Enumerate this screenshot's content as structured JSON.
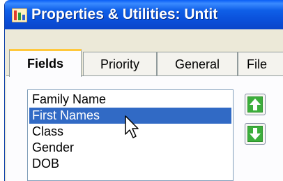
{
  "window": {
    "title": "Properties & Utilities: Untit",
    "icon": "app-icon"
  },
  "tabs": [
    {
      "label": "Fields",
      "active": true
    },
    {
      "label": "Priority",
      "active": false
    },
    {
      "label": "General",
      "active": false
    },
    {
      "label": "File",
      "active": false
    }
  ],
  "fields_list": {
    "items": [
      "Family Name",
      "First Names",
      "Class",
      "Gender",
      "DOB"
    ],
    "selected": "First Names"
  },
  "buttons": {
    "move_up_icon": "arrow-up-icon",
    "move_down_icon": "arrow-down-icon"
  },
  "colors": {
    "titlebar": "#0a4fd9",
    "selection": "#316ac5",
    "tab_highlight": "#ffc83c",
    "arrow_green": "#2fa52f"
  }
}
